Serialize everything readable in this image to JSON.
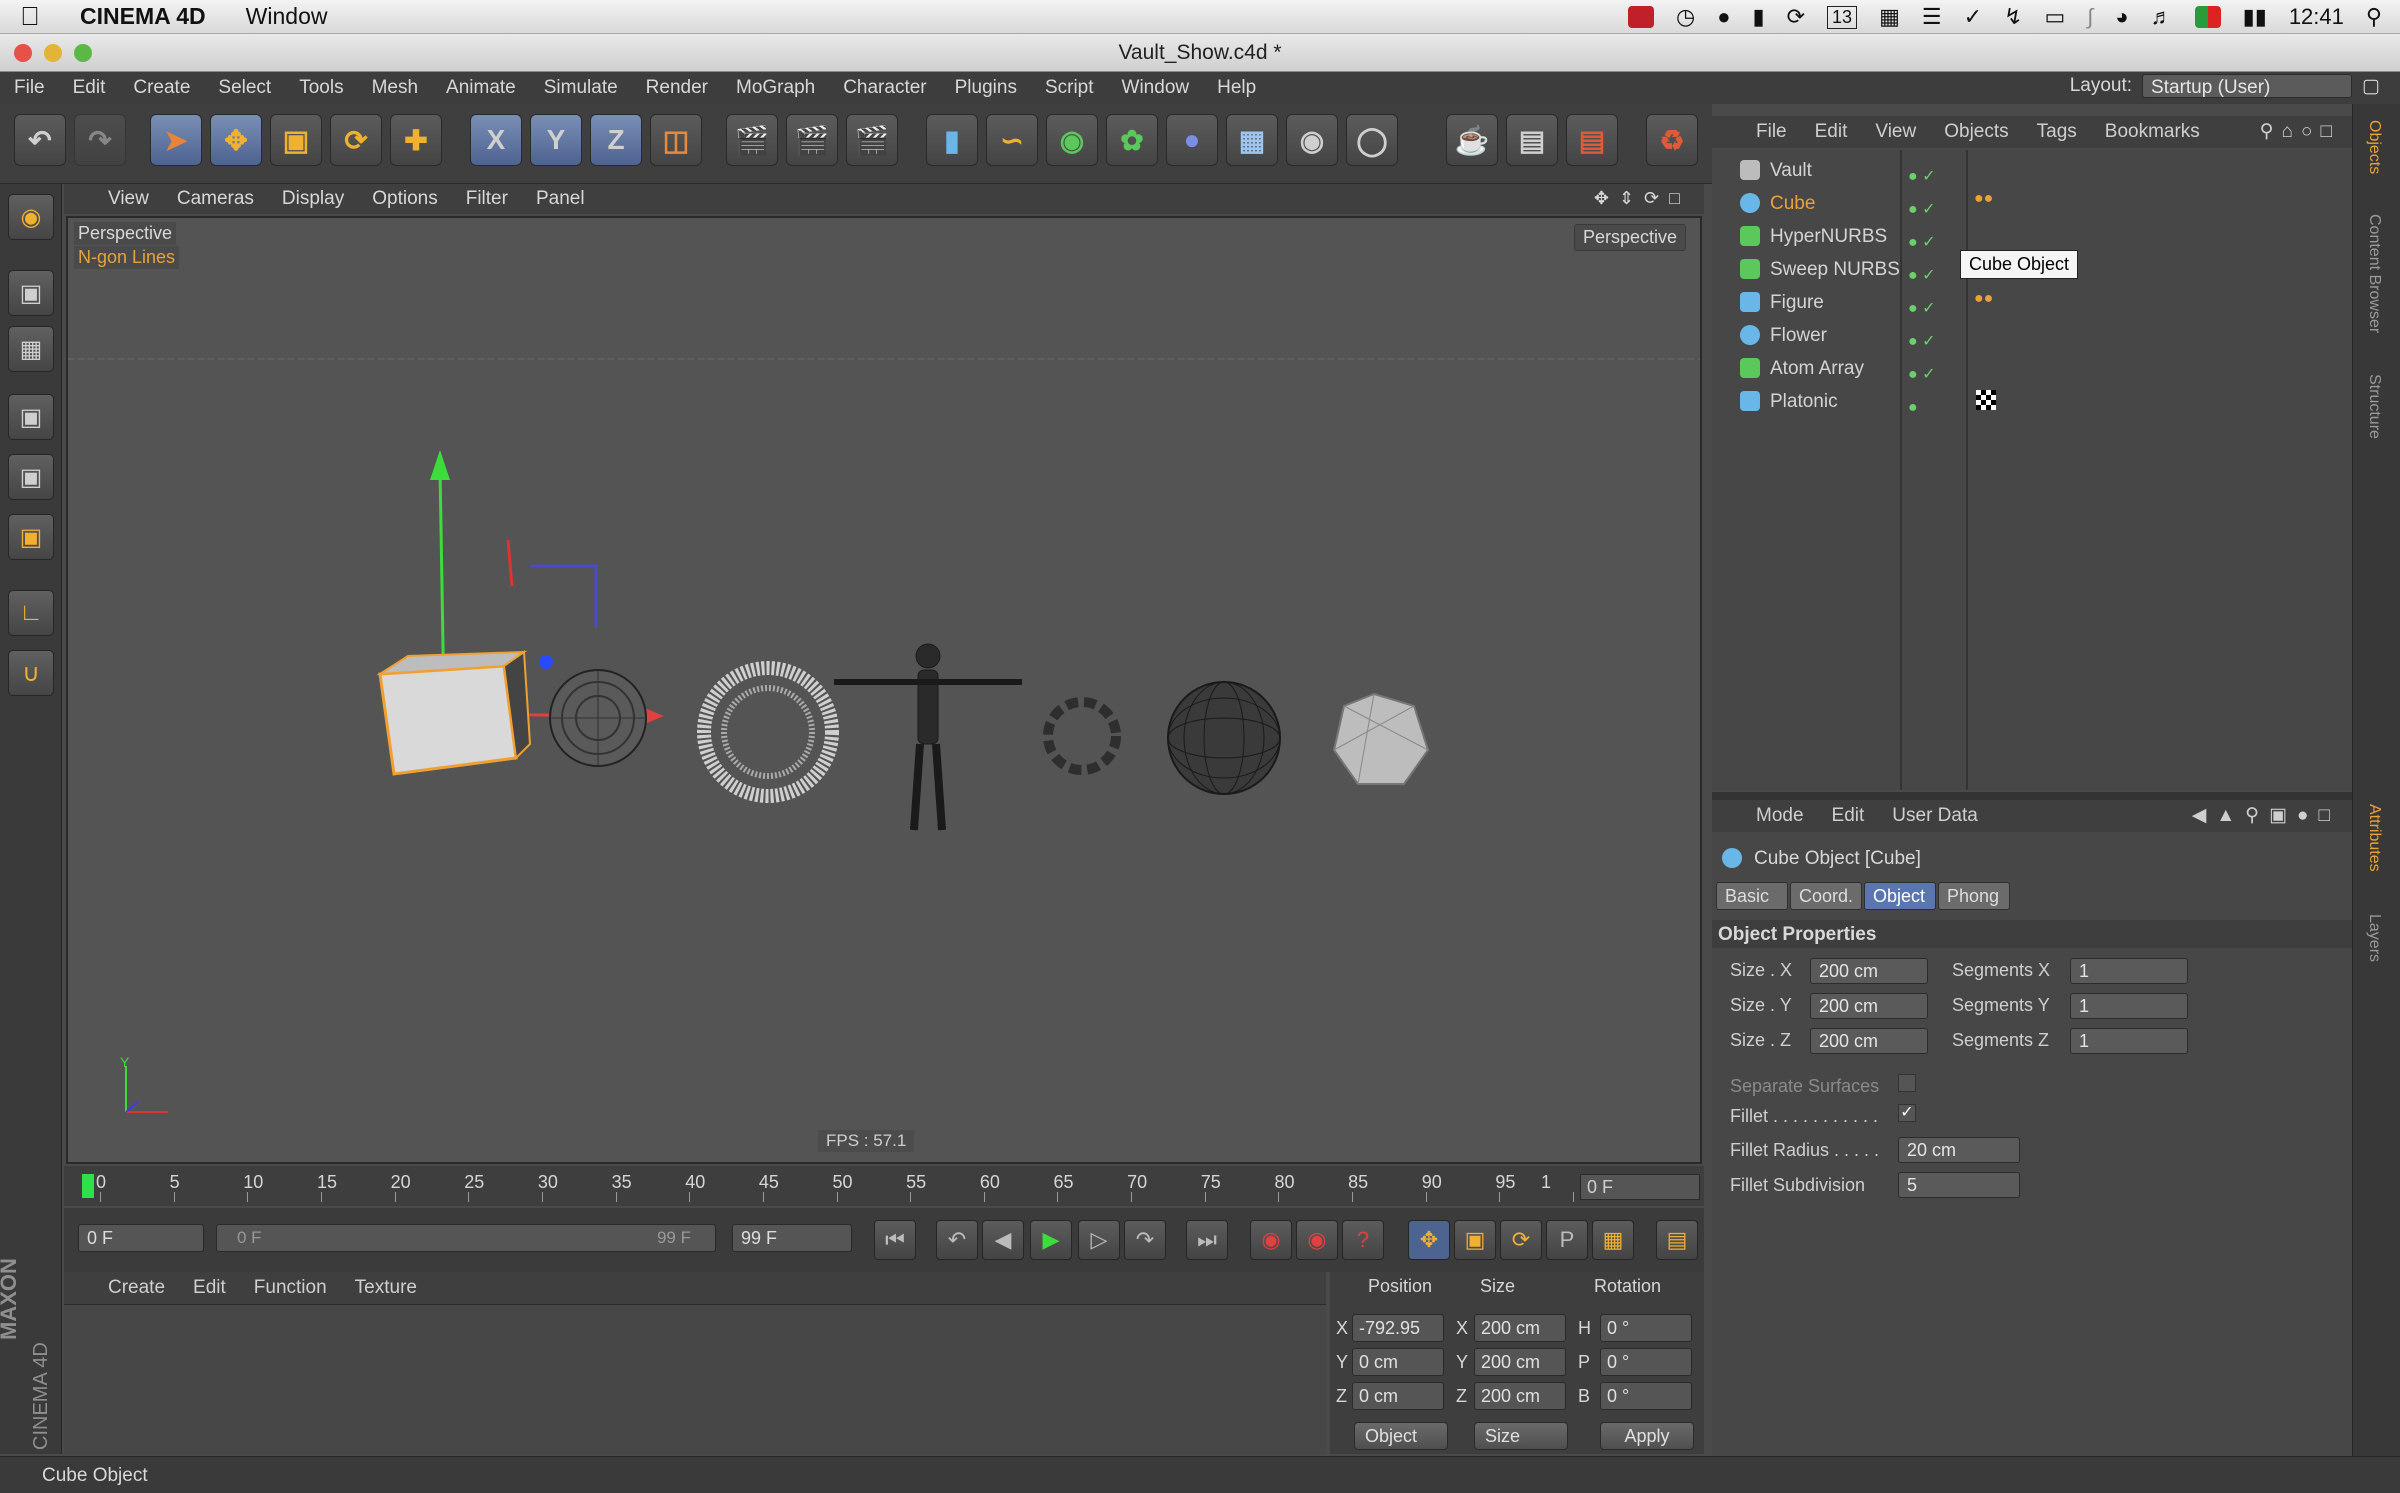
{
  "macbar": {
    "app": "CINEMA 4D",
    "menu": "Window",
    "time": "12:41",
    "calendar_day": "13"
  },
  "window": {
    "title": "Vault_Show.c4d *"
  },
  "menubar": {
    "items": [
      "File",
      "Edit",
      "Create",
      "Select",
      "Tools",
      "Mesh",
      "Animate",
      "Simulate",
      "Render",
      "MoGraph",
      "Character",
      "Plugins",
      "Script",
      "Window",
      "Help"
    ],
    "layout_label": "Layout:",
    "layout_value": "Startup (User)"
  },
  "toolbar": {
    "x_label": "X",
    "y_label": "Y",
    "z_label": "Z"
  },
  "viewport": {
    "menu": [
      "View",
      "Cameras",
      "Display",
      "Options",
      "Filter",
      "Panel"
    ],
    "view_name": "Perspective",
    "display_mode": "N-gon Lines",
    "camera_button": "Perspective",
    "fps": "FPS : 57.1",
    "axis_y": "Y"
  },
  "timeline": {
    "ticks": [
      "0",
      "5",
      "10",
      "15",
      "20",
      "25",
      "30",
      "35",
      "40",
      "45",
      "50",
      "55",
      "60",
      "65",
      "70",
      "75",
      "80",
      "85",
      "90",
      "95",
      "1"
    ],
    "current_frame": "0 F",
    "start_field": "0 F",
    "range_start": "0 F",
    "range_end": "99 F",
    "end_field": "99 F"
  },
  "material": {
    "menu": [
      "Create",
      "Edit",
      "Function",
      "Texture"
    ]
  },
  "coordinates": {
    "headers": [
      "Position",
      "Size",
      "Rotation"
    ],
    "rows": [
      {
        "axis": "X",
        "pos": "-792.95",
        "size_axis": "X",
        "size": "200 cm",
        "rot_axis": "H",
        "rot": "0 °"
      },
      {
        "axis": "Y",
        "pos": "0 cm",
        "size_axis": "Y",
        "size": "200 cm",
        "rot_axis": "P",
        "rot": "0 °"
      },
      {
        "axis": "Z",
        "pos": "0 cm",
        "size_axis": "Z",
        "size": "200 cm",
        "rot_axis": "B",
        "rot": "0 °"
      }
    ],
    "mode_object": "Object",
    "mode_size": "Size",
    "apply": "Apply"
  },
  "object_manager": {
    "menu": [
      "File",
      "Edit",
      "View",
      "Objects",
      "Tags",
      "Bookmarks"
    ],
    "objects": [
      "Vault",
      "Cube",
      "HyperNURBS",
      "Sweep NURBS",
      "Figure",
      "Flower",
      "Atom Array",
      "Platonic"
    ],
    "selected": "Cube",
    "tooltip": "Cube Object"
  },
  "right_tabs": [
    "Objects",
    "Content Browser",
    "Structure",
    "Attributes",
    "Layers"
  ],
  "attributes": {
    "menu": [
      "Mode",
      "Edit",
      "User Data"
    ],
    "title": "Cube Object [Cube]",
    "tabs": [
      "Basic",
      "Coord.",
      "Object",
      "Phong"
    ],
    "active_tab": "Object",
    "section": "Object Properties",
    "size_x_label": "Size . X",
    "size_x": "200 cm",
    "size_y_label": "Size . Y",
    "size_y": "200 cm",
    "size_z_label": "Size . Z",
    "size_z": "200 cm",
    "seg_x_label": "Segments X",
    "seg_x": "1",
    "seg_y_label": "Segments Y",
    "seg_y": "1",
    "seg_z_label": "Segments Z",
    "seg_z": "1",
    "separate_surfaces": "Separate Surfaces",
    "fillet": "Fillet . . . . . . . . . . .",
    "fillet_radius_label": "Fillet Radius . . . . .",
    "fillet_radius": "20 cm",
    "fillet_subdiv_label": "Fillet Subdivision",
    "fillet_subdiv": "5"
  },
  "status": {
    "text": "Cube Object"
  },
  "branding": {
    "maxon": "MAXON",
    "product": "CINEMA 4D"
  },
  "colors": {
    "accent_orange": "#e8a23a",
    "selection_blue": "#5a76b0"
  }
}
